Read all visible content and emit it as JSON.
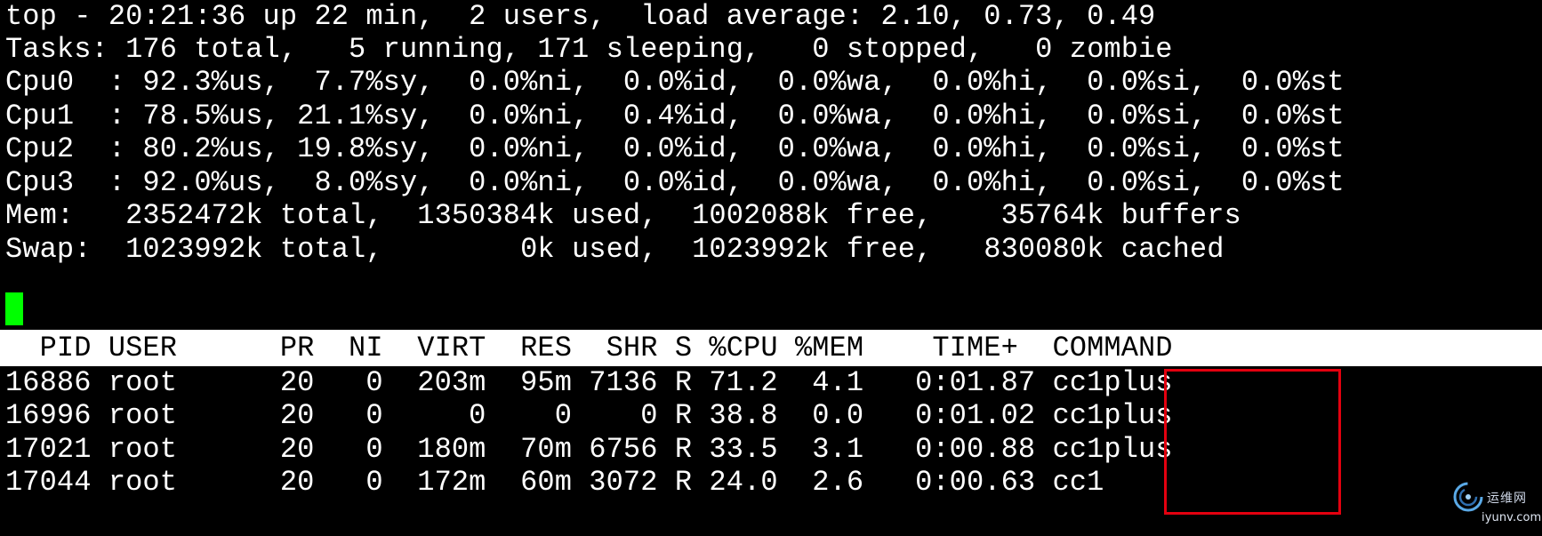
{
  "summary": {
    "line1": "top - 20:21:36 up 22 min,  2 users,  load average: 2.10, 0.73, 0.49",
    "line2": "Tasks: 176 total,   5 running, 171 sleeping,   0 stopped,   0 zombie",
    "cpu0": "Cpu0  : 92.3%us,  7.7%sy,  0.0%ni,  0.0%id,  0.0%wa,  0.0%hi,  0.0%si,  0.0%st",
    "cpu1": "Cpu1  : 78.5%us, 21.1%sy,  0.0%ni,  0.4%id,  0.0%wa,  0.0%hi,  0.0%si,  0.0%st",
    "cpu2": "Cpu2  : 80.2%us, 19.8%sy,  0.0%ni,  0.0%id,  0.0%wa,  0.0%hi,  0.0%si,  0.0%st",
    "cpu3": "Cpu3  : 92.0%us,  8.0%sy,  0.0%ni,  0.0%id,  0.0%wa,  0.0%hi,  0.0%si,  0.0%st",
    "mem": "Mem:   2352472k total,  1350384k used,  1002088k free,    35764k buffers",
    "swap": "Swap:  1023992k total,        0k used,  1023992k free,   830080k cached"
  },
  "table": {
    "header": "  PID USER      PR  NI  VIRT  RES  SHR S %CPU %MEM    TIME+  COMMAND",
    "rows": [
      "16886 root      20   0  203m  95m 7136 R 71.2  4.1   0:01.87 cc1plus",
      "16996 root      20   0     0    0    0 R 38.8  0.0   0:01.02 cc1plus",
      "17021 root      20   0  180m  70m 6756 R 33.5  3.1   0:00.88 cc1plus",
      "17044 root      20   0  172m  60m 3072 R 24.0  2.6   0:00.63 cc1"
    ]
  },
  "watermark": {
    "name_cn": "运维网",
    "url": "iyunv.com"
  },
  "colors": {
    "background": "#000000",
    "foreground": "#ffffff",
    "cursor": "#00ff00",
    "header_bg": "#ffffff",
    "highlight_border": "#e3000f"
  }
}
